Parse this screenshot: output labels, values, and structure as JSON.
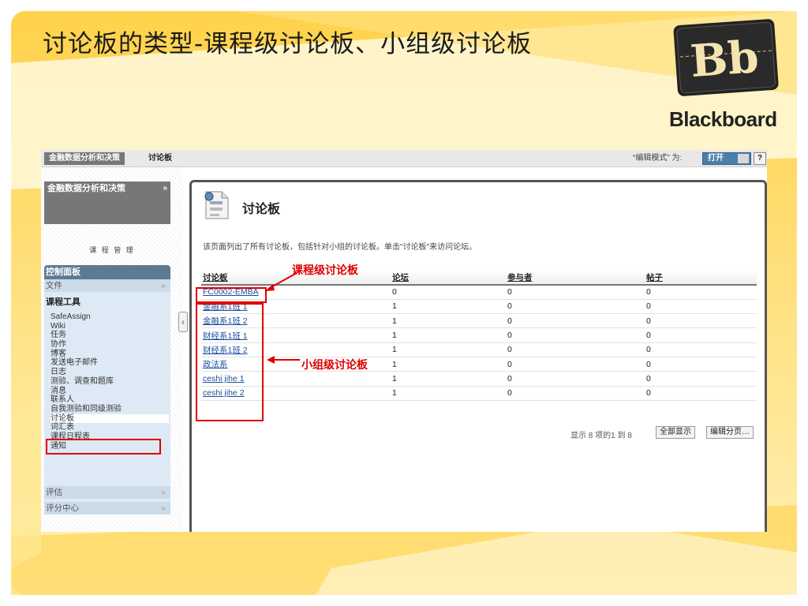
{
  "slide": {
    "title": "讨论板的类型-课程级讨论板、小组级讨论板",
    "logo_text": "Bb",
    "brand": "Blackboard"
  },
  "topbar": {
    "course_crumb": "金融数据分析和决策",
    "page_crumb": "讨论板",
    "edit_mode_label": "“编辑模式” 为:",
    "edit_mode_value": "打开",
    "help_label": "?"
  },
  "sidebar": {
    "course_name": "金融数据分析和决策",
    "course_arrow": "»",
    "course_mgmt": "课 程 管 理",
    "control_panel": "控制面板",
    "files": "文件",
    "files_arrow": "»",
    "course_tools": "课程工具",
    "tools": [
      "SafeAssign",
      "Wiki",
      "任务",
      "协作",
      "博客",
      "发送电子邮件",
      "日志",
      "测验、调查和题库",
      "消息",
      "联系人",
      "自我测验和同级测验",
      "讨论板",
      "词汇表",
      "课程日程表",
      "通知"
    ],
    "assessment": "评估",
    "assessment_arrow": "»",
    "grade_center": "评分中心",
    "grade_center_arrow": "»",
    "collapse_glyph": "‹"
  },
  "main": {
    "title": "讨论板",
    "description": "该页面列出了所有讨论板，包括针对小组的讨论板。单击\"讨论板\"来访问论坛。",
    "columns": [
      "讨论板",
      "论坛",
      "参与者",
      "帖子"
    ],
    "rows": [
      {
        "name": "FC0002-EMBA",
        "forums": "0",
        "participants": "0",
        "posts": "0"
      },
      {
        "name": "金融系1班 1",
        "forums": "1",
        "participants": "0",
        "posts": "0"
      },
      {
        "name": "金融系1班 2",
        "forums": "1",
        "participants": "0",
        "posts": "0"
      },
      {
        "name": "财经系1班 1",
        "forums": "1",
        "participants": "0",
        "posts": "0"
      },
      {
        "name": "财经系1班 2",
        "forums": "1",
        "participants": "0",
        "posts": "0"
      },
      {
        "name": "政法系",
        "forums": "1",
        "participants": "0",
        "posts": "0"
      },
      {
        "name": "ceshi jihe 1",
        "forums": "1",
        "participants": "0",
        "posts": "0"
      },
      {
        "name": "ceshi jihe 2",
        "forums": "1",
        "participants": "0",
        "posts": "0"
      }
    ],
    "pager_text": "显示 8 项的1 到 8",
    "show_all": "全部显示",
    "edit_paging": "编辑分页…"
  },
  "annotations": {
    "course_level": "课程级讨论板",
    "group_level": "小组级讨论板"
  },
  "colors": {
    "annotation": "#e00000",
    "link": "#1a4f9c",
    "panel": "#5d7a93"
  }
}
